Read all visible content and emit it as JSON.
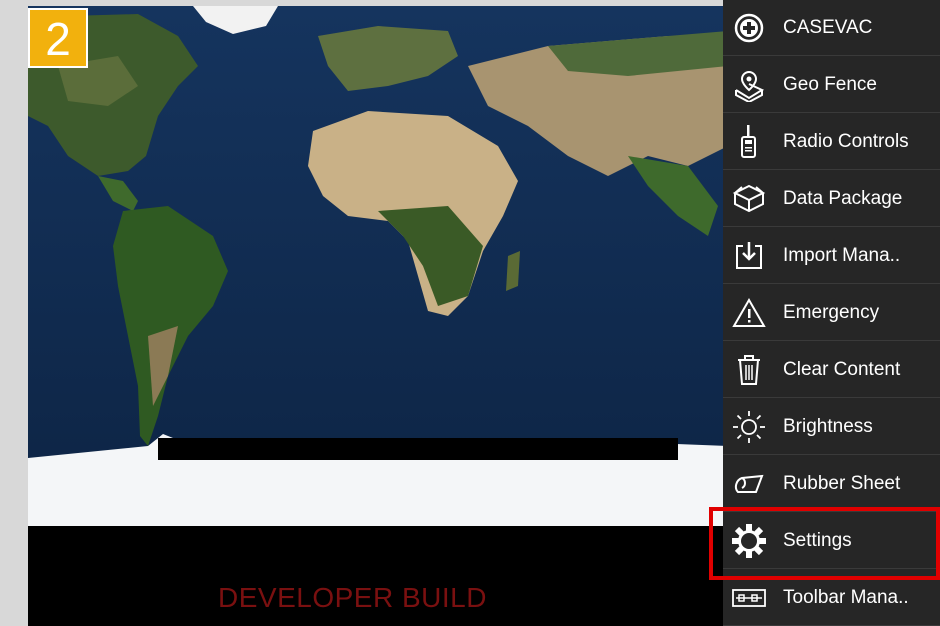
{
  "badge": {
    "label": "2"
  },
  "watermark": {
    "text": "DEVELOPER BUILD"
  },
  "colors": {
    "badge": "#f2b10d",
    "menu_bg": "#262626",
    "highlight": "#e00000",
    "dev_text": "#7a1010"
  },
  "menu": {
    "items": [
      {
        "label": "CASEVAC",
        "icon": "medical-cross-icon"
      },
      {
        "label": "Geo Fence",
        "icon": "geo-fence-icon"
      },
      {
        "label": "Radio Controls",
        "icon": "radio-icon"
      },
      {
        "label": "Data Package",
        "icon": "data-package-icon"
      },
      {
        "label": "Import Mana..",
        "icon": "import-icon"
      },
      {
        "label": "Emergency",
        "icon": "warning-triangle-icon"
      },
      {
        "label": "Clear Content",
        "icon": "trash-icon"
      },
      {
        "label": "Brightness",
        "icon": "brightness-sun-icon"
      },
      {
        "label": "Rubber Sheet",
        "icon": "rubber-sheet-icon"
      },
      {
        "label": "Settings",
        "icon": "gear-icon",
        "selected": true
      },
      {
        "label": "Toolbar Mana..",
        "icon": "toolbar-icon"
      }
    ]
  }
}
